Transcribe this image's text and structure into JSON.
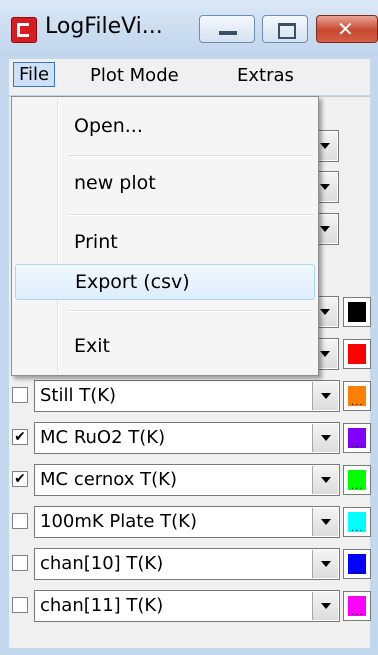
{
  "window": {
    "title": "LogFileVi...",
    "close_glyph": "✕"
  },
  "menubar": {
    "items": [
      "File",
      "Plot Mode",
      "Extras"
    ]
  },
  "file_menu": {
    "items": [
      "Open...",
      "new plot",
      "Print",
      "Export (csv)",
      "Exit"
    ],
    "highlighted": "Export (csv)"
  },
  "channels": [
    {
      "checked": false,
      "label": "Still T(K)",
      "color": "#ff8000"
    },
    {
      "checked": true,
      "label": "MC RuO2 T(K)",
      "color": "#8000ff"
    },
    {
      "checked": true,
      "label": "MC cernox T(K)",
      "color": "#00ff00"
    },
    {
      "checked": false,
      "label": "100mK Plate T(K)",
      "color": "#00ffff"
    },
    {
      "checked": false,
      "label": "chan[10] T(K)",
      "color": "#0000ff"
    },
    {
      "checked": false,
      "label": "chan[11] T(K)",
      "color": "#ff00ff"
    }
  ],
  "hidden_channel_colors": [
    "#000000",
    "#ff0000"
  ],
  "check_glyph": "✔",
  "swatch_dots": "..."
}
